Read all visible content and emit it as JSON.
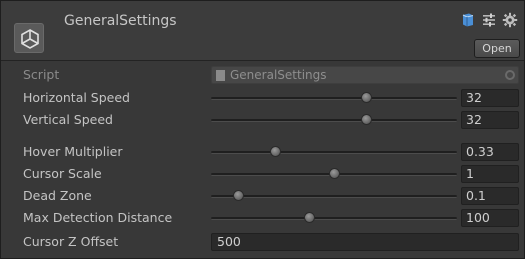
{
  "header": {
    "title": "GeneralSettings",
    "open_label": "Open",
    "icons": [
      "book-icon",
      "preset-icon",
      "gear-icon"
    ]
  },
  "script": {
    "label": "Script",
    "value": "GeneralSettings"
  },
  "fields": [
    {
      "label": "Horizontal Speed",
      "value": "32",
      "slider_fraction": 0.63
    },
    {
      "label": "Vertical Speed",
      "value": "32",
      "slider_fraction": 0.63
    },
    {
      "label": "Hover Multiplier",
      "value": "0.33",
      "slider_fraction": 0.26
    },
    {
      "label": "Cursor Scale",
      "value": "1",
      "slider_fraction": 0.5
    },
    {
      "label": "Dead Zone",
      "value": "0.1",
      "slider_fraction": 0.11
    },
    {
      "label": "Max Detection Distance",
      "value": "100",
      "slider_fraction": 0.4
    }
  ],
  "z_offset": {
    "label": "Cursor Z Offset",
    "value": "500"
  }
}
